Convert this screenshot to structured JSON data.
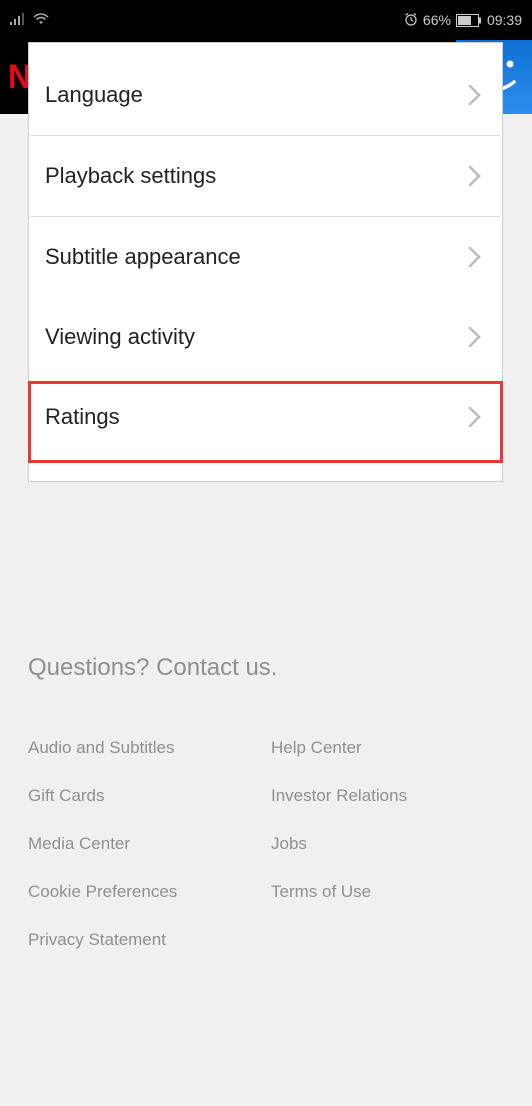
{
  "status": {
    "battery_percent": "66%",
    "time": "09:39"
  },
  "header": {
    "logo_text": "NETFLIX"
  },
  "settings": {
    "items": [
      {
        "label": "Language"
      },
      {
        "label": "Playback settings"
      },
      {
        "label": "Subtitle appearance"
      },
      {
        "label": "Viewing activity"
      },
      {
        "label": "Ratings"
      }
    ]
  },
  "footer": {
    "contact_prompt": "Questions? Contact us.",
    "links": [
      "Audio and Subtitles",
      "Help Center",
      "Gift Cards",
      "Investor Relations",
      "Media Center",
      "Jobs",
      "Cookie Preferences",
      "Terms of Use",
      "Privacy Statement"
    ]
  }
}
